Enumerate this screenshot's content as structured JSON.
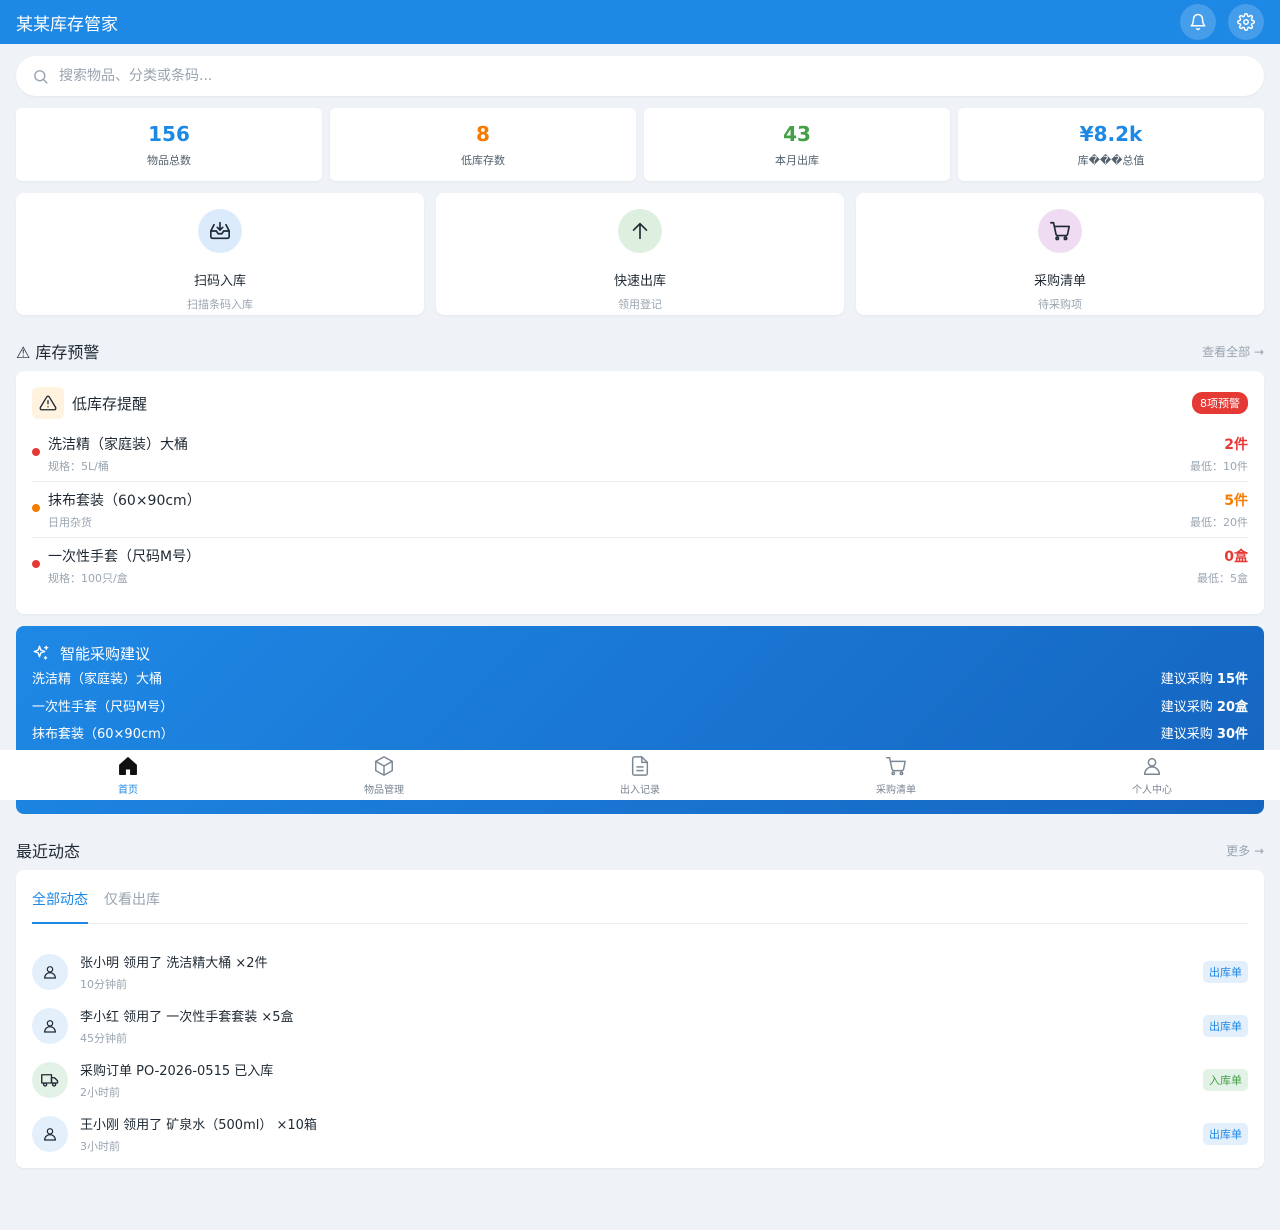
{
  "app": {
    "title": "某某库存管家"
  },
  "header": {
    "notification_icon": "bell-icon",
    "settings_icon": "gear-icon"
  },
  "search": {
    "placeholder": "搜索物品、分类或条码..."
  },
  "stats": [
    {
      "value": "156",
      "label": "物品总数",
      "color": "#1e88e5"
    },
    {
      "value": "8",
      "label": "低库存数",
      "color": "#f57c00"
    },
    {
      "value": "43",
      "label": "本月出库",
      "color": "#43a047"
    },
    {
      "value": "¥8.2k",
      "label": "库���总值",
      "color": "#1e88e5"
    }
  ],
  "quick_actions": [
    {
      "title": "扫码入库",
      "sub": "扫描条码入库",
      "icon": "inbox-in-icon",
      "bg": "#dcebfb"
    },
    {
      "title": "快速出库",
      "sub": "领用登记",
      "icon": "arrow-up-icon",
      "bg": "#ddf0e0"
    },
    {
      "title": "采购清单",
      "sub": "待采购项",
      "icon": "cart-icon",
      "bg": "#efdcf3"
    }
  ],
  "alerts_section": {
    "title": "⚠ 库存预警",
    "link": "查看全部 →"
  },
  "alerts_card": {
    "title": "低库存提醒",
    "badge": "8项预警",
    "items": [
      {
        "name": "洗洁精（家庭装）大桶",
        "sub": "规格：5L/桶",
        "qty": "2件",
        "min": "最低：10件",
        "color": "#e53935"
      },
      {
        "name": "抹布套装（60×90cm）",
        "sub": "日用杂货",
        "qty": "5件",
        "min": "最低：20件",
        "color": "#f57c00"
      },
      {
        "name": "一次性手套（尺码M号）",
        "sub": "规格：100只/盒",
        "qty": "0盒",
        "min": "最低：5盒",
        "color": "#e53935"
      }
    ]
  },
  "ai_card": {
    "title": "智能采购建议",
    "items": [
      {
        "name": "洗洁精（家庭装）大桶",
        "prefix": "建议采购",
        "amount": "15件"
      },
      {
        "name": "一次性手套（尺码M号）",
        "prefix": "建议采购",
        "amount": "20盒"
      },
      {
        "name": "抹布套装（60×90cm）",
        "prefix": "建议采购",
        "amount": "30件"
      }
    ]
  },
  "bottom_nav": [
    {
      "label": "首页",
      "icon": "home-icon",
      "active": true
    },
    {
      "label": "物品管理",
      "icon": "box-icon",
      "active": false
    },
    {
      "label": "出入记录",
      "icon": "document-icon",
      "active": false
    },
    {
      "label": "采购清单",
      "icon": "cart-icon",
      "active": false
    },
    {
      "label": "个人中心",
      "icon": "user-icon",
      "active": false
    }
  ],
  "activity_section": {
    "title": "最近动态",
    "link": "更多 →"
  },
  "activity": {
    "tabs": [
      "全部动态",
      "仅看出库"
    ],
    "items": [
      {
        "title": "张小明 领用了 洗洁精大桶 ×2件",
        "time": "10分钟前",
        "tag": "出库单",
        "icon": "user-icon",
        "avatar_bg": "#e3f0fc",
        "tag_bg": "#e3f0fc",
        "tag_color": "#1e88e5"
      },
      {
        "title": "李小红 领用了 一次性手套套装 ×5盒",
        "time": "45分钟前",
        "tag": "出库单",
        "icon": "user-icon",
        "avatar_bg": "#e3f0fc",
        "tag_bg": "#e3f0fc",
        "tag_color": "#1e88e5"
      },
      {
        "title": "采购订单 PO-2026-0515 已入库",
        "time": "2小时前",
        "tag": "入库单",
        "icon": "truck-icon",
        "avatar_bg": "#e3f2e6",
        "tag_bg": "#e3f2e6",
        "tag_color": "#43a047"
      },
      {
        "title": "王小刚 领用了 矿泉水（500ml） ×10箱",
        "time": "3小时前",
        "tag": "出库单",
        "icon": "user-icon",
        "avatar_bg": "#e3f0fc",
        "tag_bg": "#e3f0fc",
        "tag_color": "#1e88e5"
      }
    ]
  }
}
